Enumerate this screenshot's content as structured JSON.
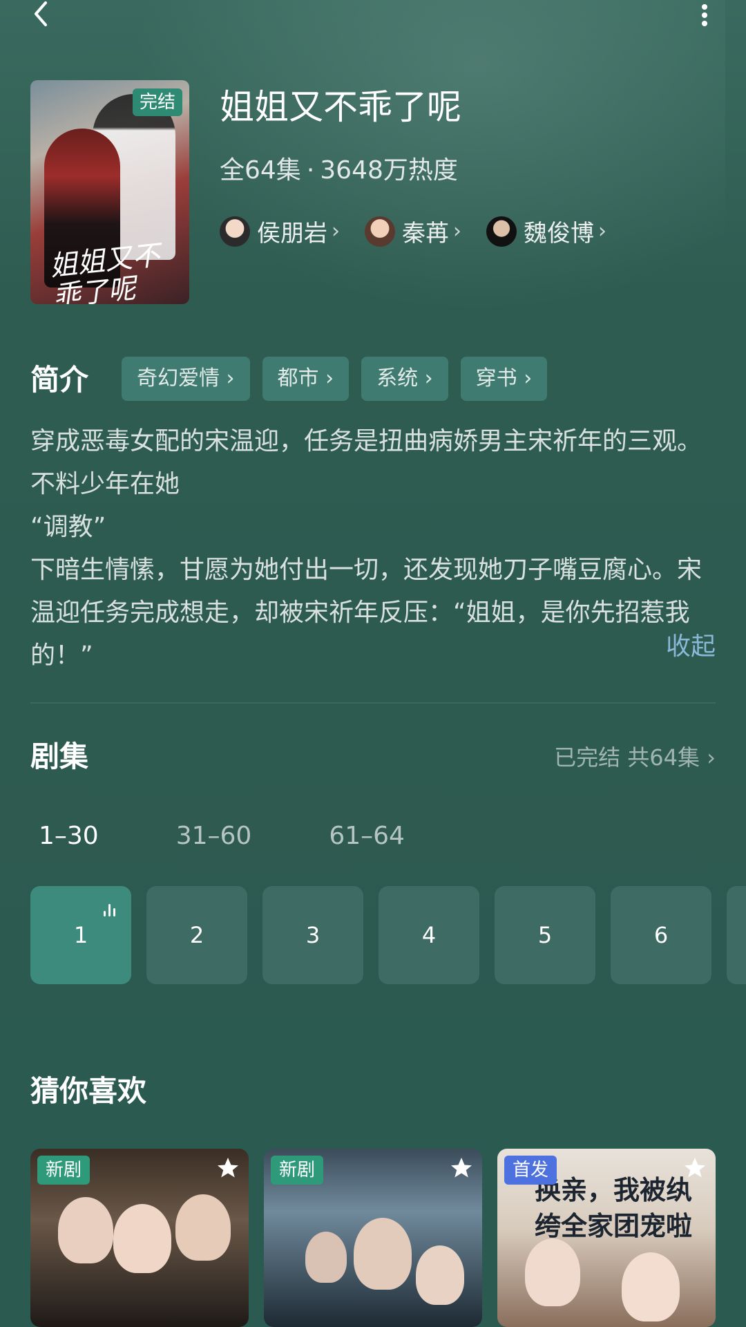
{
  "drama": {
    "title": "姐姐又不乖了呢",
    "badge": "完结",
    "cover_title": "姐姐又不乖了呢",
    "episodes_count": "全64集",
    "dot": "·",
    "heat": "3648万热度"
  },
  "cast": [
    {
      "name": "侯朋岩"
    },
    {
      "name": "秦苒"
    },
    {
      "name": "魏俊博"
    }
  ],
  "intro": {
    "label": "简介",
    "tags": [
      "奇幻爱情",
      "都市",
      "系统",
      "穿书"
    ],
    "paragraphs": [
      "穿成恶毒女配的宋温迎，任务是扭曲病娇男主宋祈年的三观。不料少年在她",
      "“调教”",
      "下暗生情愫，甘愿为她付出一切，还发现她刀子嘴豆腐心。宋温迎任务完成想走，却被宋祈年反压：“姐姐，是你先招惹我的！”"
    ],
    "collapse": "收起"
  },
  "episodes": {
    "label": "剧集",
    "status": "已完结 共64集",
    "ranges": [
      "1–30",
      "31–60",
      "61–64"
    ],
    "items": [
      "1",
      "2",
      "3",
      "4",
      "5",
      "6"
    ]
  },
  "recommend": {
    "label": "猜你喜欢",
    "items": [
      {
        "badge": "新剧"
      },
      {
        "badge": "新剧"
      },
      {
        "badge": "首发",
        "caption": "换亲，我被纨绔全家团宠啦"
      }
    ]
  },
  "colors": {
    "background": "#2d5a50",
    "tag": "#3f7b70",
    "episode_active": "#3c8b7d",
    "episode": "#3e6b63",
    "link": "#8ab8d8"
  }
}
